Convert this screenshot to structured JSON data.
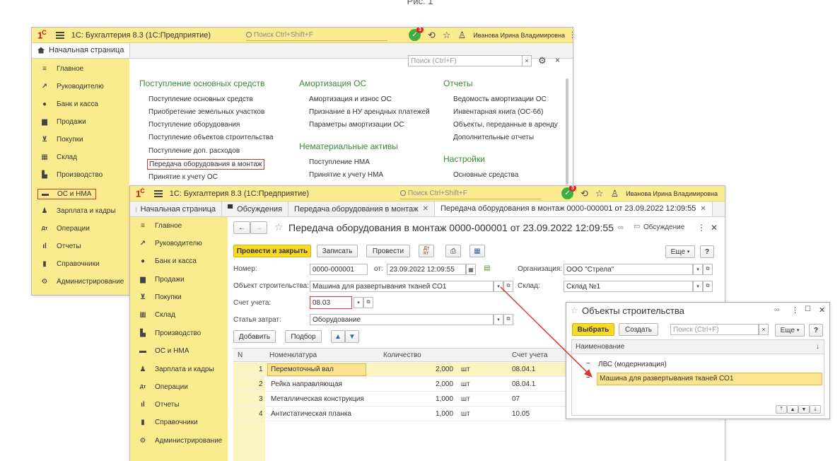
{
  "caption": "Рис. 1",
  "back": {
    "app_title": "1С: Бухгалтерия 8.3  (1С:Предприятие)",
    "search_placeholder": "Поиск Ctrl+Shift+F",
    "notif_count": "3",
    "user": "Иванова Ирина Владимировна",
    "home_tab": "Начальная страница",
    "panel_search_placeholder": "Поиск (Ctrl+F)",
    "sidebar": [
      "Главное",
      "Руководителю",
      "Банк и касса",
      "Продажи",
      "Покупки",
      "Склад",
      "Производство",
      "ОС и НМА",
      "Зарплата и кадры",
      "Операции",
      "Отчеты",
      "Справочники",
      "Администрирование"
    ],
    "col1_title": "Поступление основных средств",
    "col1_links": [
      "Поступление основных средств",
      "Приобретение земельных участков",
      "Поступление оборудования",
      "Поступление объектов строительства",
      "Поступление доп. расходов",
      "Передача оборудования в монтаж",
      "Принятие к учету ОС"
    ],
    "col2_title": "Амортизация ОС",
    "col2_links": [
      "Амортизация и износ ОС",
      "Признание в НУ арендных платежей",
      "Параметры амортизации ОС"
    ],
    "col2b_title": "Нематериальные активы",
    "col2b_links": [
      "Поступление НМА",
      "Принятие к учету НМА"
    ],
    "col3_title": "Отчеты",
    "col3_links": [
      "Ведомость амортизации ОС",
      "Инвентарная книга (ОС-6б)",
      "Объекты, переданные в аренду",
      "Дополнительные отчеты"
    ],
    "col3b_title": "Настройки",
    "col3b_links": [
      "Основные средства"
    ]
  },
  "front": {
    "app_title": "1С: Бухгалтерия 8.3  (1С:Предприятие)",
    "search_placeholder": "Поиск Ctrl+Shift+F",
    "notif_count": "3",
    "user": "Иванова Ирина Владимировна",
    "tabs": [
      "Начальная страница",
      "Обсуждения",
      "Передача оборудования в монтаж",
      "Передача оборудования в монтаж 0000-000001 от 23.09.2022 12:09:55"
    ],
    "sidebar": [
      "Главное",
      "Руководителю",
      "Банк и касса",
      "Продажи",
      "Покупки",
      "Склад",
      "Производство",
      "ОС и НМА",
      "Зарплата и кадры",
      "Операции",
      "Отчеты",
      "Справочники",
      "Администрирование"
    ],
    "doc_title": "Передача оборудования в монтаж 0000-000001 от 23.09.2022 12:09:55",
    "discussion": "Обсуждение",
    "buttons": {
      "post_close": "Провести и закрыть",
      "save": "Записать",
      "post": "Провести",
      "more": "Еще",
      "help": "?",
      "add": "Добавить",
      "pick": "Подбор"
    },
    "fields": {
      "number_label": "Номер:",
      "number": "0000-000001",
      "from_label": "от:",
      "date": "23.09.2022 12:09:55",
      "org_label": "Организация:",
      "org": "ООО \"Стрела\"",
      "object_label": "Объект строительства:",
      "object": "Машина для развертывания тканей СО1",
      "warehouse_label": "Склад:",
      "warehouse": "Склад №1",
      "account_label": "Счет учета:",
      "account": "08.03",
      "cost_label": "Статья затрат:",
      "cost": "Оборудование"
    },
    "table": {
      "headers": [
        "N",
        "Номенклатура",
        "Количество",
        "Счет учета"
      ],
      "rows": [
        {
          "n": "1",
          "name": "Перемоточный вал",
          "qty": "2,000",
          "unit": "шт",
          "acc": "08.04.1"
        },
        {
          "n": "2",
          "name": "Рейка направляющая",
          "qty": "2,000",
          "unit": "шт",
          "acc": "08.04.1"
        },
        {
          "n": "3",
          "name": "Металлическая конструкция",
          "qty": "1,000",
          "unit": "шт",
          "acc": "07"
        },
        {
          "n": "4",
          "name": "Антистатическая планка",
          "qty": "1,000",
          "unit": "шт",
          "acc": "10.05"
        }
      ]
    }
  },
  "dialog": {
    "title": "Объекты строительства",
    "select": "Выбрать",
    "create": "Создать",
    "search_placeholder": "Поиск (Ctrl+F)",
    "more": "Еще",
    "help": "?",
    "column": "Наименование",
    "items": [
      "ЛВС (модернизация)",
      "Машина для развертывания тканей СО1"
    ]
  }
}
